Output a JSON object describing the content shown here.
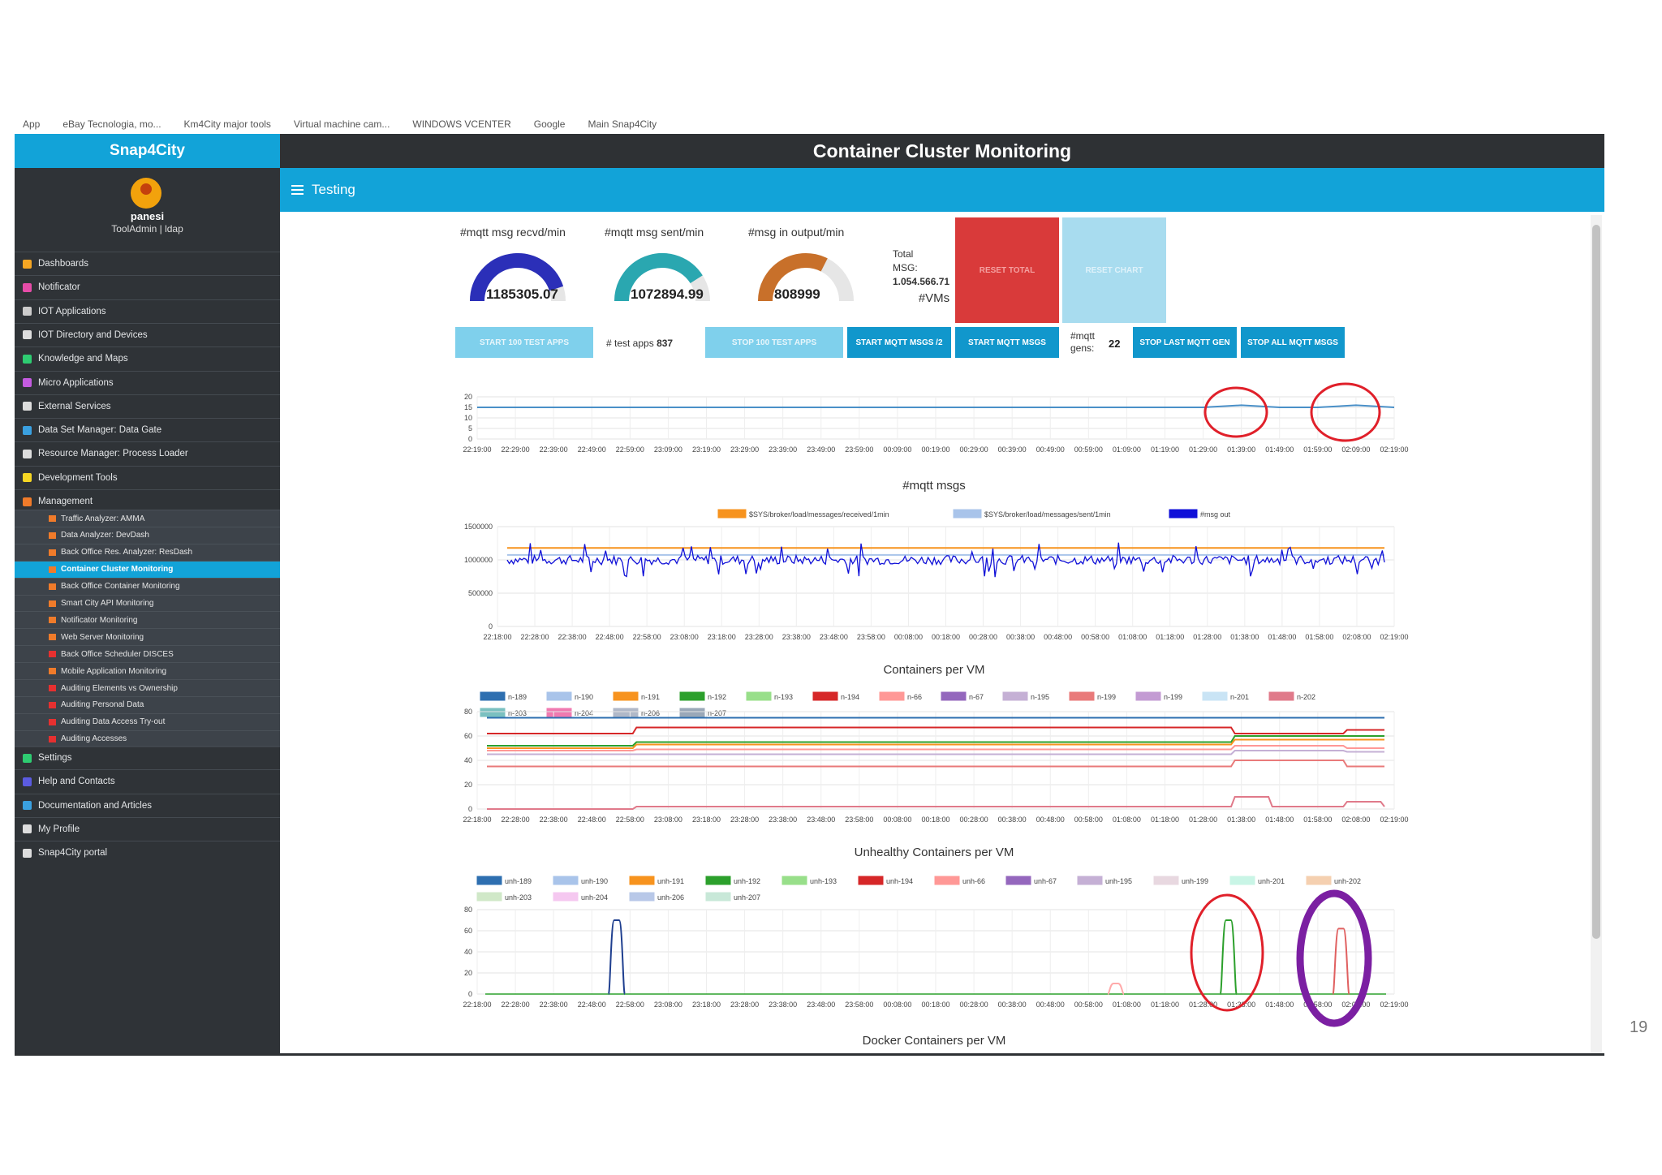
{
  "bookmarks": [
    "App",
    "eBay Tecnologia, mo...",
    "Km4City major tools",
    "Virtual machine cam...",
    "WINDOWS VCENTER",
    "Google",
    "Main Snap4City"
  ],
  "sidebar": {
    "brand": "Snap4City",
    "user_name": "panesi",
    "user_role": "ToolAdmin | ldap",
    "items": [
      {
        "label": "Dashboards",
        "color": "#f5a623"
      },
      {
        "label": "Notificator",
        "color": "#e64ca8"
      },
      {
        "label": "IOT Applications",
        "color": "#cccccc"
      },
      {
        "label": "IOT Directory and Devices",
        "color": "#dddddd"
      },
      {
        "label": "Knowledge and Maps",
        "color": "#2ecc71"
      },
      {
        "label": "Micro Applications",
        "color": "#c45be0"
      },
      {
        "label": "External Services",
        "color": "#dddddd"
      },
      {
        "label": "Data Set Manager: Data Gate",
        "color": "#3aa0e0"
      },
      {
        "label": "Resource Manager: Process Loader",
        "color": "#dddddd"
      },
      {
        "label": "Development Tools",
        "color": "#f5d623"
      },
      {
        "label": "Management",
        "color": "#f07b2a"
      }
    ],
    "sub_items": [
      {
        "label": "Traffic Analyzer: AMMA",
        "color": "#f07b2a"
      },
      {
        "label": "Data Analyzer: DevDash",
        "color": "#f07b2a"
      },
      {
        "label": "Back Office Res. Analyzer: ResDash",
        "color": "#f07b2a"
      },
      {
        "label": "Container Cluster Monitoring",
        "color": "#f07b2a"
      },
      {
        "label": "Back Office Container Monitoring",
        "color": "#f07b2a"
      },
      {
        "label": "Smart City API Monitoring",
        "color": "#f07b2a"
      },
      {
        "label": "Notificator Monitoring",
        "color": "#f07b2a"
      },
      {
        "label": "Web Server Monitoring",
        "color": "#f07b2a"
      },
      {
        "label": "Back Office Scheduler DISCES",
        "color": "#e63030"
      },
      {
        "label": "Mobile Application Monitoring",
        "color": "#f07b2a"
      },
      {
        "label": "Auditing Elements vs Ownership",
        "color": "#e63030"
      },
      {
        "label": "Auditing Personal Data",
        "color": "#e63030"
      },
      {
        "label": "Auditing Data Access Try-out",
        "color": "#e63030"
      },
      {
        "label": "Auditing Accesses",
        "color": "#e63030"
      }
    ],
    "bottom_items": [
      {
        "label": "Settings",
        "color": "#2ecc71"
      },
      {
        "label": "Help and Contacts",
        "color": "#5b5be0"
      },
      {
        "label": "Documentation and Articles",
        "color": "#3aa0e0"
      },
      {
        "label": "My Profile",
        "color": "#dddddd"
      },
      {
        "label": "Snap4City portal",
        "color": "#dddddd"
      }
    ]
  },
  "header": {
    "title": "Container Cluster Monitoring",
    "section": "Testing"
  },
  "gauges": [
    {
      "title": "#mqtt msg recvd/min",
      "value": "1185305.07",
      "color": "#2b2fb8",
      "fill": 0.9
    },
    {
      "title": "#mqtt msg sent/min",
      "value": "1072894.99",
      "color": "#2aa7b0",
      "fill": 0.82
    },
    {
      "title": "#msg in output/min",
      "value": "808999",
      "color": "#c8702a",
      "fill": 0.65
    }
  ],
  "total": {
    "label_1": "Total",
    "label_2": "MSG:",
    "value": "1.054.566.71"
  },
  "buttons": {
    "reset_total": "RESET TOTAL",
    "reset_chart": "RESET CHART",
    "start_test_apps": "START 100 TEST APPS",
    "test_apps_label": "# test apps",
    "test_apps_value": "837",
    "stop_test_apps": "STOP 100 TEST APPS",
    "start_mqtt_2": "START MQTT MSGS /2",
    "start_mqtt": "START MQTT MSGS",
    "mqtt_gens_label_1": "#mqtt",
    "mqtt_gens_label_2": "gens:",
    "mqtt_gens_value": "22",
    "stop_last_gen": "STOP LAST MQTT GEN",
    "stop_all": "STOP ALL MQTT MSGS"
  },
  "time_ticks_a": [
    "22:19:00",
    "22:29:00",
    "22:39:00",
    "22:49:00",
    "22:59:00",
    "23:09:00",
    "23:19:00",
    "23:29:00",
    "23:39:00",
    "23:49:00",
    "23:59:00",
    "00:09:00",
    "00:19:00",
    "00:29:00",
    "00:39:00",
    "00:49:00",
    "00:59:00",
    "01:09:00",
    "01:19:00",
    "01:29:00",
    "01:39:00",
    "01:49:00",
    "01:59:00",
    "02:09:00",
    "02:19:00"
  ],
  "time_ticks_b": [
    "22:18:00",
    "22:28:00",
    "22:38:00",
    "22:48:00",
    "22:58:00",
    "23:08:00",
    "23:18:00",
    "23:28:00",
    "23:38:00",
    "23:48:00",
    "23:58:00",
    "00:08:00",
    "00:18:00",
    "00:28:00",
    "00:38:00",
    "00:48:00",
    "00:58:00",
    "01:08:00",
    "01:18:00",
    "01:28:00",
    "01:38:00",
    "01:48:00",
    "01:58:00",
    "02:08:00",
    "02:19:00"
  ],
  "chart_data": [
    {
      "type": "line",
      "title": "#VMs",
      "yticks": [
        "20",
        "15",
        "10",
        "5",
        "0"
      ],
      "ylim": [
        0,
        20
      ],
      "series": [
        {
          "values": [
            15,
            15,
            15,
            15,
            15,
            15,
            15,
            15,
            15,
            15,
            15,
            15,
            15,
            15,
            15,
            15,
            15,
            15,
            15,
            15,
            16,
            15,
            15,
            16,
            15
          ],
          "color": "#4a90c8"
        }
      ]
    },
    {
      "type": "line",
      "title": "#mqtt msgs",
      "yticks": [
        "1500000",
        "1000000",
        "500000",
        "0"
      ],
      "ylim": [
        0,
        1500000
      ],
      "legend": [
        {
          "name": "$SYS/broker/load/messages/received/1min",
          "color": "#f7931e"
        },
        {
          "name": "$SYS/broker/load/messages/sent/1min",
          "color": "#a9c4ea"
        },
        {
          "name": "#msg out",
          "color": "#1010d8"
        }
      ],
      "received": 1180000,
      "sent": 1075000,
      "out_mean": 1000000
    },
    {
      "type": "line",
      "title": "Containers per VM",
      "yticks": [
        "80",
        "60",
        "40",
        "20",
        "0"
      ],
      "ylim": [
        0,
        80
      ],
      "legend": [
        {
          "name": "n-189",
          "color": "#2e6fb0"
        },
        {
          "name": "n-190",
          "color": "#a9c4ea"
        },
        {
          "name": "n-191",
          "color": "#f7931e"
        },
        {
          "name": "n-192",
          "color": "#2ca02c"
        },
        {
          "name": "n-193",
          "color": "#98df8a"
        },
        {
          "name": "n-194",
          "color": "#d62728"
        },
        {
          "name": "n-66",
          "color": "#ff9896"
        },
        {
          "name": "n-67",
          "color": "#9467bd"
        },
        {
          "name": "n-195",
          "color": "#c5b0d5"
        },
        {
          "name": "n-199",
          "color": "#e97a7a"
        },
        {
          "name": "n-199",
          "color": "#c39bd3"
        },
        {
          "name": "n-201",
          "color": "#c9e4f5"
        },
        {
          "name": "n-202",
          "color": "#e07a8a"
        },
        {
          "name": "n-203",
          "color": "#7ac0c0"
        },
        {
          "name": "n-204",
          "color": "#f07ab0"
        },
        {
          "name": "n-206",
          "color": "#b0b8c8"
        },
        {
          "name": "n-207",
          "color": "#9aa8b8"
        }
      ],
      "series": [
        {
          "name": "n-189",
          "color": "#2e6fb0",
          "values": [
            75,
            75,
            75,
            75,
            75,
            75,
            75,
            75,
            75,
            75,
            75,
            75,
            75,
            75,
            75,
            75,
            75,
            75,
            75,
            75,
            75,
            75,
            75,
            75,
            75
          ]
        },
        {
          "name": "n-194",
          "color": "#d62728",
          "values": [
            62,
            62,
            62,
            62,
            67,
            67,
            67,
            67,
            67,
            67,
            67,
            67,
            67,
            67,
            67,
            67,
            67,
            67,
            67,
            67,
            62,
            62,
            62,
            65,
            65
          ]
        },
        {
          "name": "n-192",
          "color": "#2ca02c",
          "values": [
            52,
            52,
            52,
            52,
            55,
            55,
            55,
            55,
            55,
            55,
            55,
            55,
            55,
            55,
            55,
            55,
            55,
            55,
            55,
            55,
            60,
            60,
            60,
            60,
            60
          ]
        },
        {
          "name": "n-191",
          "color": "#f7931e",
          "values": [
            50,
            50,
            50,
            50,
            53,
            53,
            53,
            53,
            53,
            53,
            53,
            53,
            53,
            53,
            53,
            53,
            53,
            53,
            53,
            53,
            57,
            57,
            57,
            57,
            57
          ]
        },
        {
          "name": "n-66",
          "color": "#ff9896",
          "values": [
            48,
            48,
            48,
            48,
            49,
            49,
            49,
            49,
            49,
            49,
            49,
            49,
            49,
            49,
            49,
            49,
            49,
            49,
            49,
            49,
            52,
            52,
            52,
            50,
            50
          ]
        },
        {
          "name": "n-195",
          "color": "#c5b0d5",
          "values": [
            45,
            45,
            45,
            45,
            45,
            45,
            45,
            45,
            45,
            45,
            45,
            45,
            45,
            45,
            45,
            45,
            45,
            45,
            45,
            45,
            48,
            48,
            48,
            47,
            47
          ]
        },
        {
          "name": "n-199",
          "color": "#e97a7a",
          "values": [
            35,
            35,
            35,
            35,
            35,
            35,
            35,
            35,
            35,
            35,
            35,
            35,
            35,
            35,
            35,
            35,
            35,
            35,
            35,
            35,
            40,
            40,
            40,
            35,
            35
          ]
        },
        {
          "name": "n-202",
          "color": "#e07a8a",
          "values": [
            0,
            0,
            0,
            0,
            2,
            2,
            2,
            2,
            2,
            2,
            2,
            2,
            2,
            2,
            2,
            2,
            2,
            2,
            2,
            2,
            10,
            2,
            2,
            6,
            2
          ]
        }
      ]
    },
    {
      "type": "line",
      "title": "Unhealthy Containers per VM",
      "yticks": [
        "80",
        "60",
        "40",
        "20",
        "0"
      ],
      "ylim": [
        0,
        80
      ],
      "legend": [
        {
          "name": "unh-189",
          "color": "#2e6fb0"
        },
        {
          "name": "unh-190",
          "color": "#a9c4ea"
        },
        {
          "name": "unh-191",
          "color": "#f7931e"
        },
        {
          "name": "unh-192",
          "color": "#2ca02c"
        },
        {
          "name": "unh-193",
          "color": "#98df8a"
        },
        {
          "name": "unh-194",
          "color": "#d62728"
        },
        {
          "name": "unh-66",
          "color": "#ff9896"
        },
        {
          "name": "unh-67",
          "color": "#9467bd"
        },
        {
          "name": "unh-195",
          "color": "#c5b0d5"
        },
        {
          "name": "unh-199",
          "color": "#e8d8e0"
        },
        {
          "name": "unh-201",
          "color": "#c9f5e6"
        },
        {
          "name": "unh-202",
          "color": "#f5d0b0"
        },
        {
          "name": "unh-203",
          "color": "#d0e8c8"
        },
        {
          "name": "unh-204",
          "color": "#f5c8f0"
        },
        {
          "name": "unh-206",
          "color": "#b8c8e8"
        },
        {
          "name": "unh-207",
          "color": "#c8e8d8"
        }
      ],
      "spikes": [
        {
          "color": "#1f3f8f",
          "at": 3.5,
          "value": 70
        },
        {
          "color": "#2ca02c",
          "at": 19.8,
          "value": 70
        },
        {
          "color": "#e06060",
          "at": 22.8,
          "value": 62
        },
        {
          "color": "#ffaaaa",
          "at": 16.8,
          "value": 10
        }
      ]
    }
  ],
  "next_chart_title": "Docker Containers per VM",
  "page_number": "19"
}
